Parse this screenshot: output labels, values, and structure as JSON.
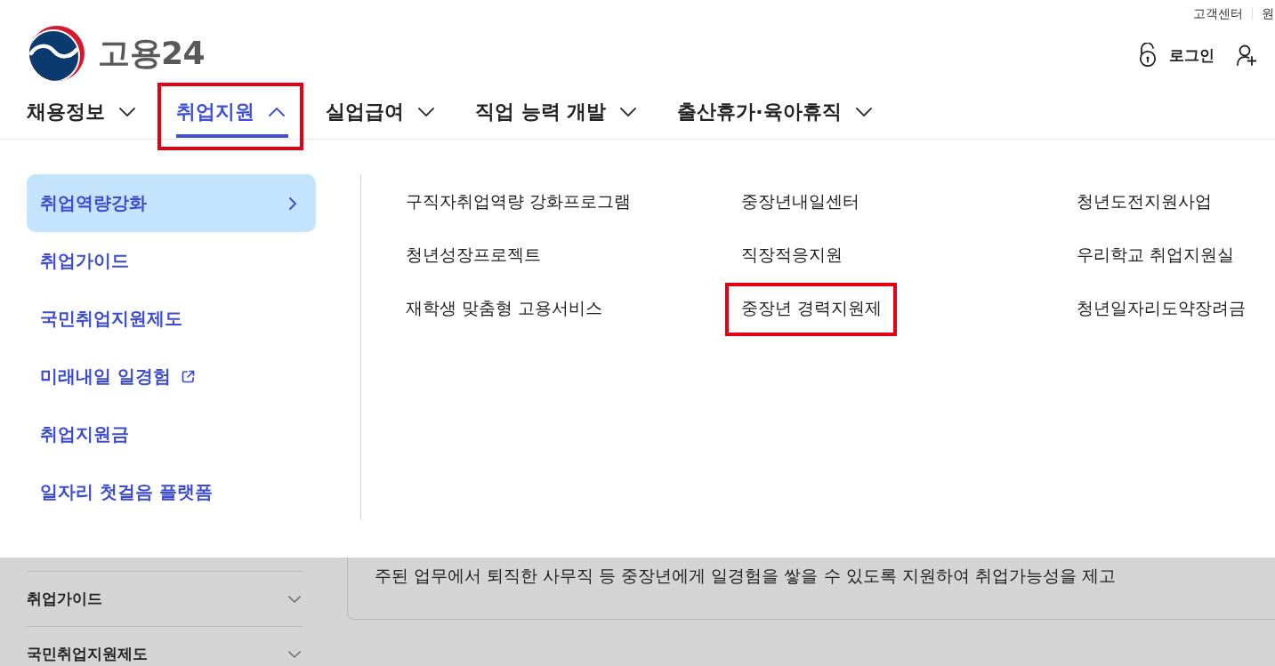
{
  "utility_links": [
    {
      "label": "고객센터"
    },
    {
      "label": "원"
    }
  ],
  "logo": {
    "text": "고용24"
  },
  "account_actions": [
    {
      "kind": "login",
      "label": "로그인"
    },
    {
      "kind": "signup"
    }
  ],
  "nav": [
    {
      "label": "채용정보",
      "selected": false,
      "expanded": false,
      "highlighted": false
    },
    {
      "label": "취업지원",
      "selected": true,
      "expanded": true,
      "highlighted": true
    },
    {
      "label": "실업급여",
      "selected": false,
      "expanded": false,
      "highlighted": false
    },
    {
      "label": "직업 능력 개발",
      "selected": false,
      "expanded": false,
      "highlighted": false
    },
    {
      "label": "출산휴가·육아휴직",
      "selected": false,
      "expanded": false,
      "highlighted": false
    }
  ],
  "mega_menu": {
    "categories": [
      {
        "label": "취업역량강화",
        "selected": true,
        "external": false
      },
      {
        "label": "취업가이드",
        "selected": false,
        "external": false
      },
      {
        "label": "국민취업지원제도",
        "selected": false,
        "external": false
      },
      {
        "label": "미래내일 일경험",
        "selected": false,
        "external": true
      },
      {
        "label": "취업지원금",
        "selected": false,
        "external": false
      },
      {
        "label": "일자리 첫걸음 플랫폼",
        "selected": false,
        "external": false
      }
    ],
    "links": [
      {
        "label": "구직자취업역량 강화프로그램",
        "highlighted": false
      },
      {
        "label": "중장년내일센터",
        "highlighted": false
      },
      {
        "label": "청년도전지원사업",
        "highlighted": false
      },
      {
        "label": "청년성장프로젝트",
        "highlighted": false
      },
      {
        "label": "직장적응지원",
        "highlighted": false
      },
      {
        "label": "우리학교 취업지원실",
        "highlighted": false
      },
      {
        "label": "재학생 맞춤형 고용서비스",
        "highlighted": false
      },
      {
        "label": "중장년 경력지원제",
        "highlighted": true
      },
      {
        "label": "청년일자리도약장려금",
        "highlighted": false
      }
    ]
  },
  "page_behind": {
    "sidebar": [
      {
        "label": "취업가이드",
        "expanded": false
      },
      {
        "label": "국민취업지원제도",
        "expanded": false
      }
    ],
    "card": {
      "text": "주된 업무에서 퇴직한 사무직 등 중장년에게 일경험을 쌓을 수 있도록 지원하여 취업가능성을 제고"
    }
  }
}
